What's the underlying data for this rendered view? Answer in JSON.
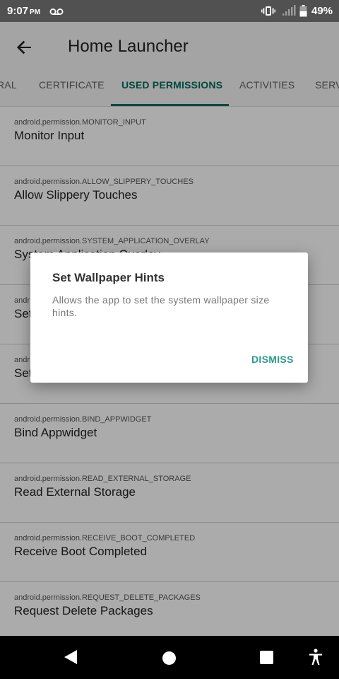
{
  "status": {
    "time": "9:07",
    "ampm": "PM",
    "battery": "49%",
    "icons": [
      "voicemail-icon",
      "vibrate-icon",
      "signal-icon",
      "battery-icon"
    ]
  },
  "app_bar": {
    "title": "Home Launcher",
    "back_icon": "arrow-back-icon"
  },
  "tabs": [
    {
      "label": "RAL"
    },
    {
      "label": "CERTIFICATE"
    },
    {
      "label": "USED PERMISSIONS",
      "active": true
    },
    {
      "label": "ACTIVITIES"
    },
    {
      "label": "SERV"
    }
  ],
  "permissions": [
    {
      "key": "android.permission.MONITOR_INPUT",
      "name": "Monitor Input"
    },
    {
      "key": "android.permission.ALLOW_SLIPPERY_TOUCHES",
      "name": "Allow Slippery Touches"
    },
    {
      "key": "android.permission.SYSTEM_APPLICATION_OVERLAY",
      "name": "System Application Overlay"
    },
    {
      "key": "andr",
      "name": "Set"
    },
    {
      "key": "andr",
      "name": "Set"
    },
    {
      "key": "android.permission.BIND_APPWIDGET",
      "name": "Bind Appwidget"
    },
    {
      "key": "android.permission.READ_EXTERNAL_STORAGE",
      "name": "Read External Storage"
    },
    {
      "key": "android.permission.RECEIVE_BOOT_COMPLETED",
      "name": "Receive Boot Completed"
    },
    {
      "key": "android.permission.REQUEST_DELETE_PACKAGES",
      "name": "Request Delete Packages"
    }
  ],
  "dialog": {
    "title": "Set Wallpaper Hints",
    "body": "Allows the app to set the system wallpaper size hints.",
    "dismiss_label": "DISMISS"
  },
  "colors": {
    "accent": "#006d5b",
    "dialog_button": "#2a9a8a",
    "status_bar": "#515151"
  },
  "nav": {
    "icons": [
      "nav-back-icon",
      "nav-home-icon",
      "nav-recents-icon",
      "accessibility-icon"
    ]
  }
}
